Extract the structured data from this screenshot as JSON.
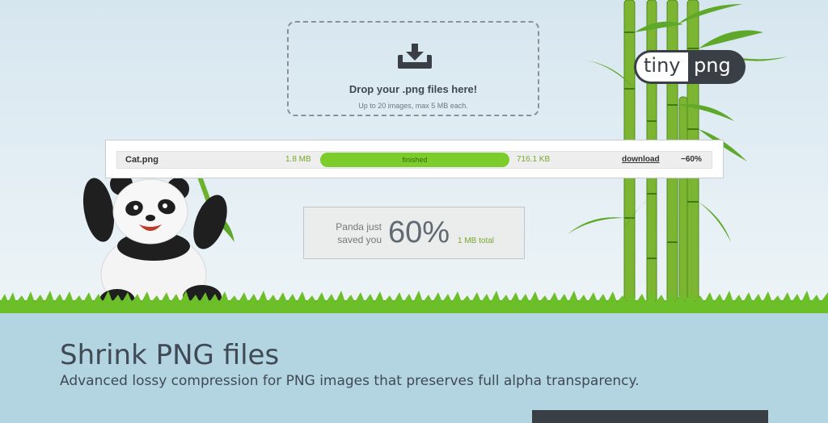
{
  "dropzone": {
    "icon": "download-tray-icon",
    "title": "Drop your .png files here!",
    "subtitle": "Up to 20 images, max 5 MB each."
  },
  "logo": {
    "left_text": "tiny",
    "right_text": "png"
  },
  "file": {
    "name": "Cat.png",
    "original_size": "1.8 MB",
    "status": "finished",
    "progress_fraction": 1.0,
    "compressed_size": "716.1 KB",
    "download_label": "download",
    "reduction": "−60%"
  },
  "savings": {
    "line1": "Panda just",
    "line2": "saved you",
    "percent": "60%",
    "total": "1 MB total"
  },
  "main": {
    "heading": "Shrink PNG files",
    "subheading": "Advanced lossy compression for PNG images that preserves full alpha transparency."
  },
  "colors": {
    "accent_green": "#7ccd2c",
    "text_green": "#77a82a",
    "dark_text": "#3f4a55",
    "lower_bg": "#b3d5e1"
  }
}
